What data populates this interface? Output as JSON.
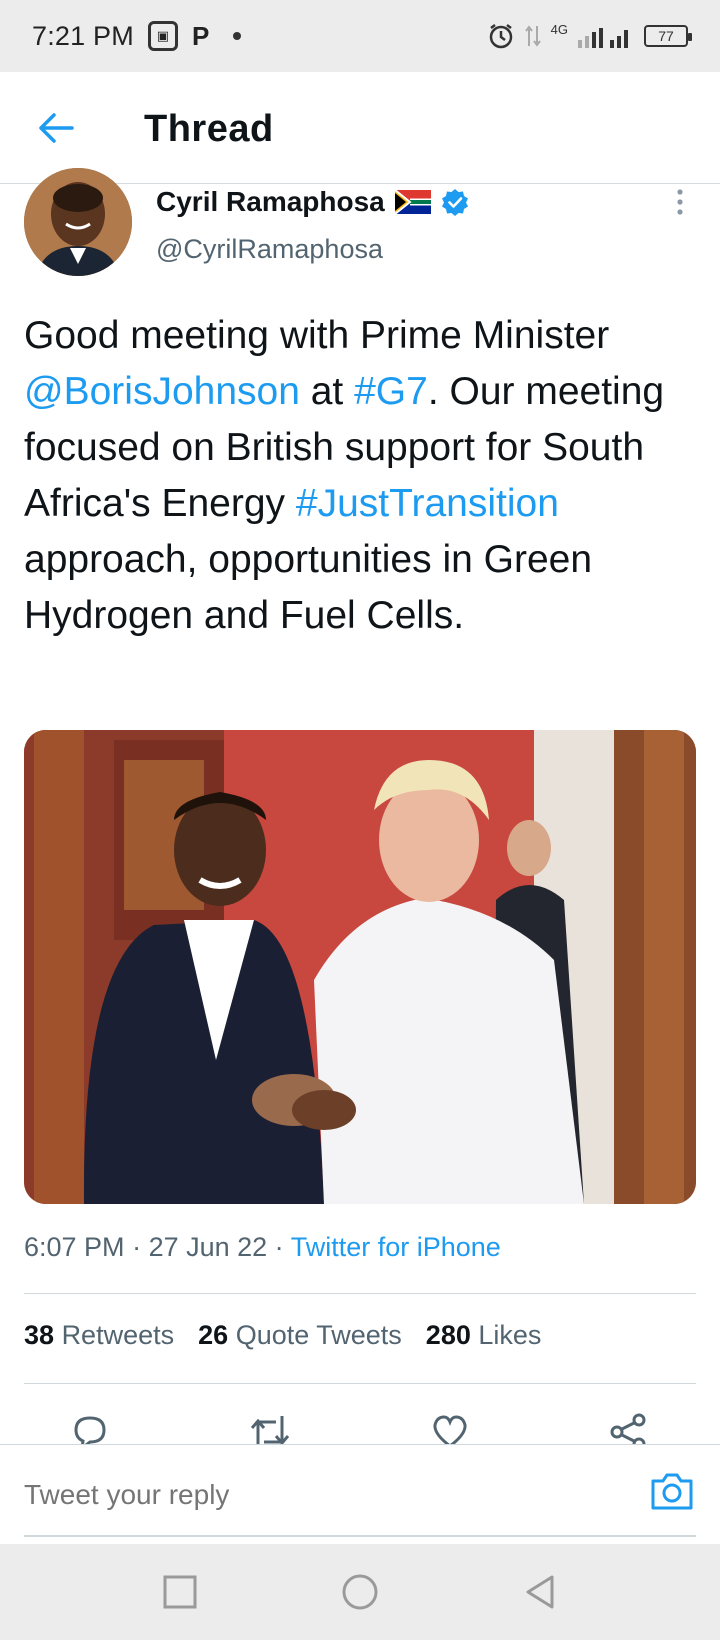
{
  "status_bar": {
    "time": "7:21 PM",
    "network": "4G",
    "battery": "77"
  },
  "header": {
    "title": "Thread"
  },
  "tweet": {
    "display_name": "Cyril Ramaphosa",
    "handle": "@CyrilRamaphosa",
    "text_parts": {
      "p1": "Good meeting with Prime Minister ",
      "mention": "@BorisJohnson",
      "p2": " at ",
      "hashtag1": "#G7",
      "p3": ". Our meeting focused on British support for South Africa's Energy ",
      "hashtag2": "#JustTransition",
      "p4": " approach, opportunities in Green Hydrogen and Fuel Cells."
    },
    "time": "6:07 PM",
    "date": "27 Jun 22",
    "source": "Twitter for iPhone",
    "separator": " · "
  },
  "stats": {
    "retweets_count": "38",
    "retweets_label": "Retweets",
    "quotes_count": "26",
    "quotes_label": "Quote Tweets",
    "likes_count": "280",
    "likes_label": "Likes"
  },
  "reply": {
    "placeholder": "Tweet your reply"
  },
  "colors": {
    "accent": "#1d9bf0",
    "text": "#0f1419",
    "secondary": "#536471"
  },
  "icons": [
    "back-arrow-icon",
    "verified-badge-icon",
    "south-africa-flag-icon",
    "more-options-icon",
    "reply-icon",
    "retweet-icon",
    "like-icon",
    "share-icon",
    "camera-icon"
  ]
}
